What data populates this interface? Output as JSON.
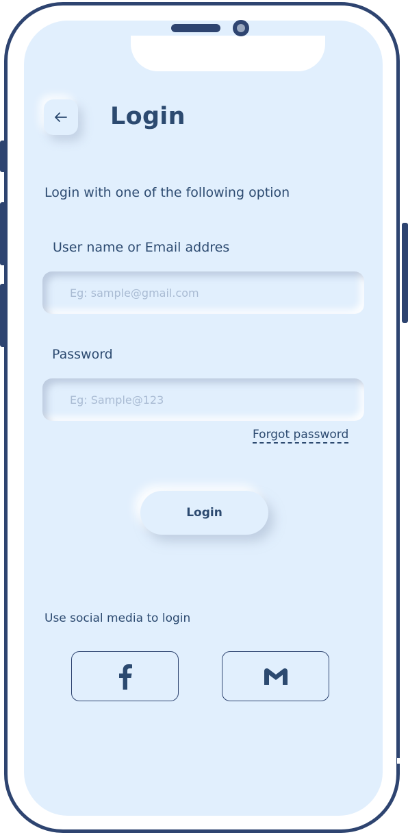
{
  "header": {
    "back_icon": "arrow-left-icon",
    "title": "Login"
  },
  "form": {
    "subtitle": "Login with one of the following option",
    "username": {
      "label": "User name or Email addres",
      "placeholder": "Eg: sample@gmail.com",
      "value": ""
    },
    "password": {
      "label": "Password",
      "placeholder": "Eg: Sample@123",
      "value": ""
    },
    "forgot_password": "Forgot password",
    "login_button": "Login"
  },
  "social": {
    "title": "Use social media to login",
    "buttons": [
      {
        "icon": "facebook-icon"
      },
      {
        "icon": "gmail-icon"
      }
    ]
  },
  "colors": {
    "primary": "#2c4a70",
    "background": "#e1effd",
    "placeholder": "#a9bbd3",
    "frame": "#2e4470"
  }
}
